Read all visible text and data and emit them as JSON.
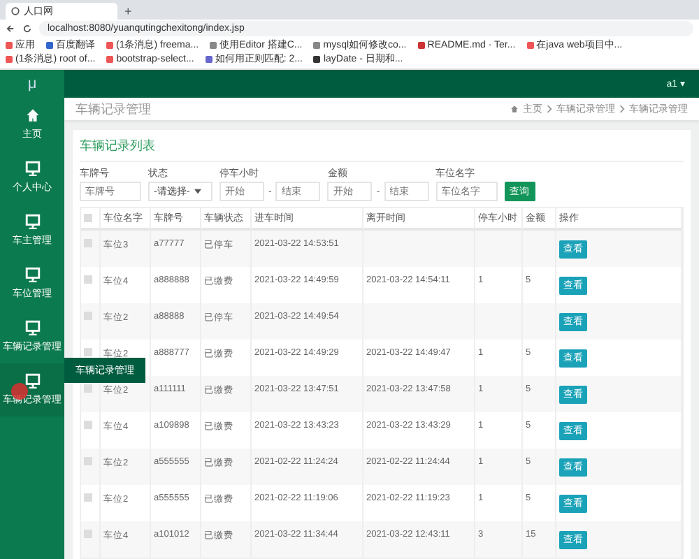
{
  "browser": {
    "tab_title": "人口网",
    "new_tab": "+",
    "url": "localhost:8080/yuanqutingchexitong/index.jsp",
    "bookmarks": [
      "应用",
      "百度翻译",
      "(1条消息) freema...",
      "使用Editor 搭建C...",
      "mysql如何修改co...",
      "README.md · Ter...",
      "在java web项目中...",
      "(1条消息) root of...",
      "bootstrap-select...",
      "如何用正则匹配: 2...",
      "layDate - 日期和..."
    ]
  },
  "header": {
    "logo": "μ",
    "user": "a1 ▾"
  },
  "sidebar": {
    "items": [
      {
        "label": "主页",
        "kind": "home",
        "selected": false
      },
      {
        "label": "个人中心",
        "kind": "monitor",
        "selected": false
      },
      {
        "label": "车主管理",
        "kind": "monitor",
        "selected": false
      },
      {
        "label": "车位管理",
        "kind": "monitor",
        "selected": false
      },
      {
        "label": "车辆记录管理",
        "kind": "monitor",
        "selected": false
      },
      {
        "label": "车辆记录管理",
        "kind": "monitor",
        "selected": true
      }
    ],
    "tooltip": "车辆记录管理"
  },
  "page": {
    "title": "车辆记录管理",
    "breadcrumbs": [
      "主页",
      "车辆记录管理",
      "车辆记录管理"
    ]
  },
  "card": {
    "title": "车辆记录列表"
  },
  "filters": [
    {
      "kind": "text",
      "label": "车牌号",
      "placeholder": "车牌号"
    },
    {
      "kind": "select",
      "label": "状态",
      "value": "-请选择-"
    },
    {
      "kind": "range",
      "label": "停车小时",
      "fields": [
        {
          "placeholder": "开始"
        },
        {
          "placeholder": "结束"
        }
      ],
      "sep": "-"
    },
    {
      "kind": "range",
      "label": "金额",
      "fields": [
        {
          "placeholder": "开始"
        },
        {
          "placeholder": "结束"
        }
      ],
      "sep": "-"
    },
    {
      "kind": "text",
      "label": "车位名字",
      "placeholder": "车位名字"
    }
  ],
  "search_button": "查询",
  "table": {
    "select_all": {
      "checked": false
    },
    "columns": [
      "车位名字",
      "车牌号",
      "车辆状态",
      "进车时间",
      "离开时间",
      "停车小时",
      "金额",
      "操作"
    ],
    "rows": [
      {
        "selected": false,
        "cells": [
          "车位3",
          "a77777",
          "已停车",
          "2021-03-22 14:53:51",
          "",
          "",
          ""
        ],
        "action": "查看"
      },
      {
        "selected": false,
        "cells": [
          "车位4",
          "a888888",
          "已缴费",
          "2021-03-22 14:49:59",
          "2021-03-22 14:54:11",
          "1",
          "5"
        ],
        "action": "查看"
      },
      {
        "selected": false,
        "cells": [
          "车位2",
          "a88888",
          "已停车",
          "2021-03-22 14:49:54",
          "",
          "",
          ""
        ],
        "action": "查看"
      },
      {
        "selected": false,
        "cells": [
          "车位2",
          "a888777",
          "已缴费",
          "2021-03-22 14:49:29",
          "2021-03-22 14:49:47",
          "1",
          "5"
        ],
        "action": "查看"
      },
      {
        "selected": false,
        "cells": [
          "车位2",
          "a111111",
          "已缴费",
          "2021-03-22 13:47:51",
          "2021-03-22 13:47:58",
          "1",
          "5"
        ],
        "action": "查看"
      },
      {
        "selected": false,
        "cells": [
          "车位4",
          "a109898",
          "已缴费",
          "2021-03-22 13:43:23",
          "2021-03-22 13:43:29",
          "1",
          "5"
        ],
        "action": "查看"
      },
      {
        "selected": false,
        "cells": [
          "车位2",
          "a555555",
          "已缴费",
          "2021-02-22 11:24:24",
          "2021-02-22 11:24:44",
          "1",
          "5"
        ],
        "action": "查看"
      },
      {
        "selected": false,
        "cells": [
          "车位2",
          "a555555",
          "已缴费",
          "2021-02-22 11:19:06",
          "2021-02-22 11:19:23",
          "1",
          "5"
        ],
        "action": "查看"
      },
      {
        "selected": false,
        "cells": [
          "车位4",
          "a101012",
          "已缴费",
          "2021-03-22 11:34:44",
          "2021-03-22 12:43:11",
          "3",
          "15"
        ],
        "action": "查看"
      }
    ]
  }
}
